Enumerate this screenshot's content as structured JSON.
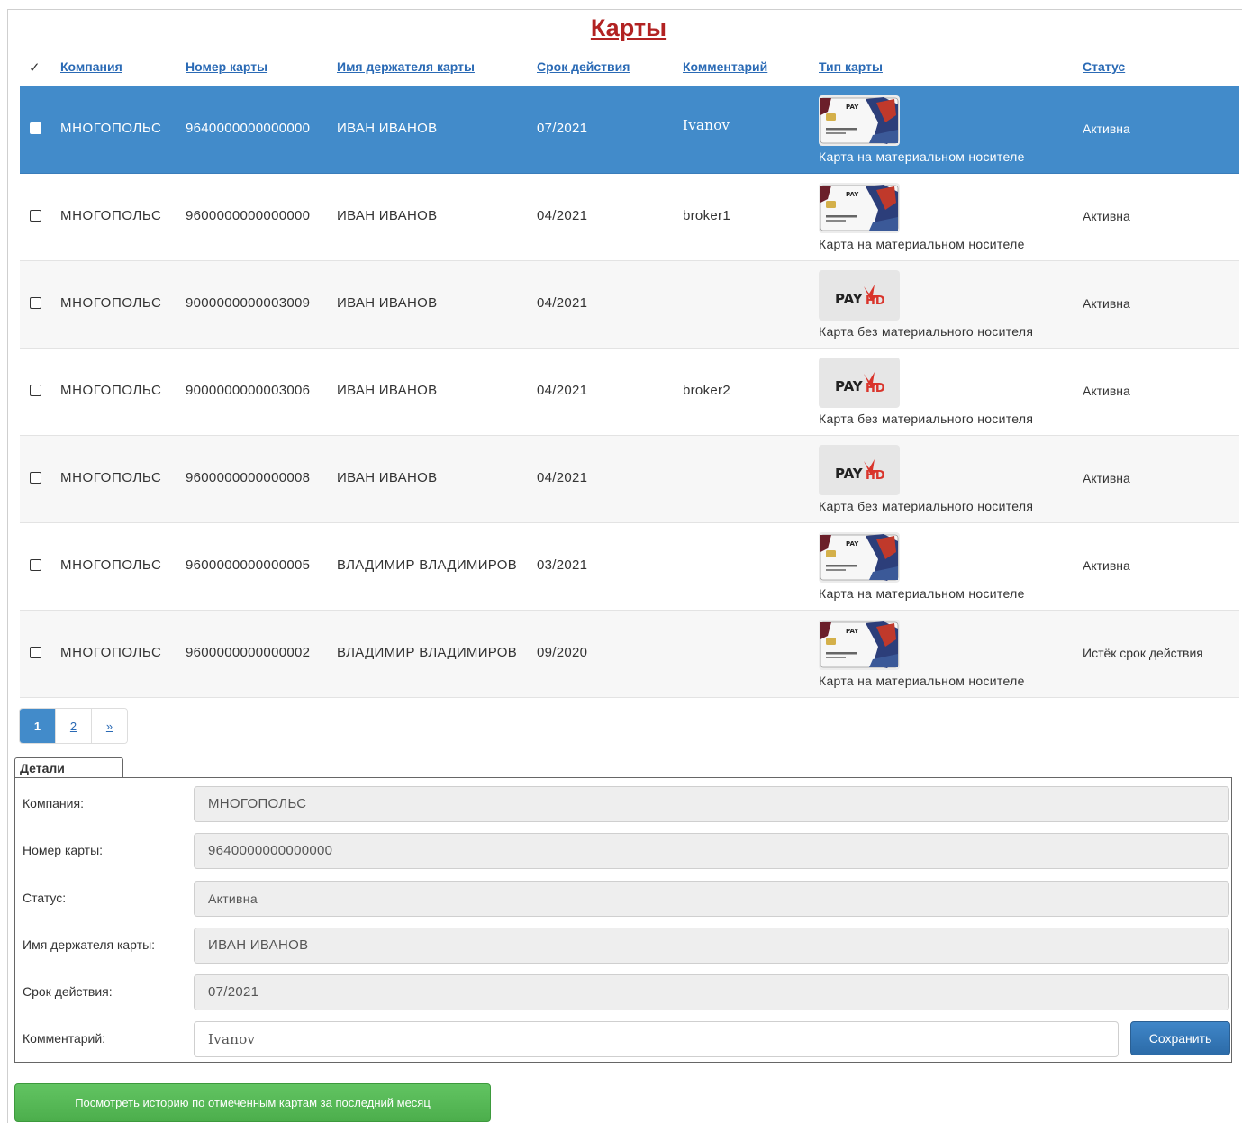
{
  "page": {
    "title": "Карты"
  },
  "table": {
    "headers": {
      "check": "✓",
      "company": "Компания",
      "number": "Номер карты",
      "holder": "Имя держателя карты",
      "expiry": "Срок действия",
      "comment": "Комментарий",
      "type": "Тип карты",
      "status": "Статус"
    },
    "rows": [
      {
        "company": "МНОГОПОЛЬС",
        "number": "9640000000000000",
        "holder": "ИВАН ИВАНОВ",
        "expiry": "07/2021",
        "comment": "Ivanov",
        "card_image": "physical-card-image",
        "type": "Карта на материальном носителе",
        "status": "Активна",
        "selected": true
      },
      {
        "company": "МНОГОПОЛЬС",
        "number": "9600000000000000",
        "holder": "ИВАН ИВАНОВ",
        "expiry": "04/2021",
        "comment": "broker1",
        "card_image": "physical-card-image",
        "type": "Карта на материальном носителе",
        "status": "Активна",
        "selected": false
      },
      {
        "company": "МНОГОПОЛЬС",
        "number": "9000000000003009",
        "holder": "ИВАН ИВАНОВ",
        "expiry": "04/2021",
        "comment": "",
        "card_image": "payhd-logo",
        "type": "Карта без материального носителя",
        "status": "Активна",
        "selected": false
      },
      {
        "company": "МНОГОПОЛЬС",
        "number": "9000000000003006",
        "holder": "ИВАН ИВАНОВ",
        "expiry": "04/2021",
        "comment": "broker2",
        "card_image": "payhd-logo",
        "type": "Карта без материального носителя",
        "status": "Активна",
        "selected": false
      },
      {
        "company": "МНОГОПОЛЬС",
        "number": "9600000000000008",
        "holder": "ИВАН ИВАНОВ",
        "expiry": "04/2021",
        "comment": "",
        "card_image": "payhd-logo",
        "type": "Карта без материального носителя",
        "status": "Активна",
        "selected": false
      },
      {
        "company": "МНОГОПОЛЬС",
        "number": "9600000000000005",
        "holder": "ВЛАДИМИР ВЛАДИМИРОВ",
        "expiry": "03/2021",
        "comment": "",
        "card_image": "physical-card-image",
        "type": "Карта на материальном носителе",
        "status": "Активна",
        "selected": false
      },
      {
        "company": "МНОГОПОЛЬС",
        "number": "9600000000000002",
        "holder": "ВЛАДИМИР ВЛАДИМИРОВ",
        "expiry": "09/2020",
        "comment": "",
        "card_image": "physical-card-image",
        "type": "Карта на материальном носителе",
        "status": "Истёк срок действия",
        "selected": false
      }
    ]
  },
  "pagination": {
    "pages": [
      "1",
      "2",
      "»"
    ],
    "current": "1"
  },
  "details": {
    "tab_label": "Детали",
    "company_label": "Компания:",
    "company_value": "МНОГОПОЛЬС",
    "number_label": "Номер карты:",
    "number_value": "9640000000000000",
    "status_label": "Статус:",
    "status_value": "Активна",
    "holder_label": "Имя держателя карты:",
    "holder_value": "ИВАН ИВАНОВ",
    "expiry_label": "Срок действия:",
    "expiry_value": "07/2021",
    "comment_label": "Комментарий:",
    "comment_value": "Ivanov",
    "save_label": "Сохранить"
  },
  "history_button": "Посмотреть историю по отмеченным картам за последний месяц",
  "colors": {
    "title": "#b22222",
    "link": "#2a6ab5",
    "selected_row": "#428bca",
    "history_button": "#5cb85c",
    "save_button": "#337ab7"
  }
}
